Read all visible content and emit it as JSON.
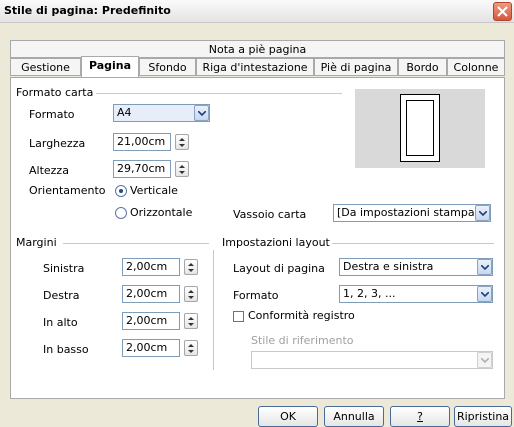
{
  "window": {
    "title": "Stile di pagina: Predefinito"
  },
  "tabs": {
    "top_row": [
      {
        "label": "Nota a piè pagina"
      }
    ],
    "bottom_row": [
      {
        "label": "Gestione"
      },
      {
        "label": "Pagina",
        "active": true
      },
      {
        "label": "Sfondo"
      },
      {
        "label": "Riga d'intestazione"
      },
      {
        "label": "Piè di pagina"
      },
      {
        "label": "Bordo"
      },
      {
        "label": "Colonne"
      }
    ]
  },
  "formato_carta": {
    "title": "Formato carta",
    "formato_label": "Formato",
    "formato_value": "A4",
    "larghezza_label": "Larghezza",
    "larghezza_value": "21,00cm",
    "altezza_label": "Altezza",
    "altezza_value": "29,70cm",
    "orientamento_label": "Orientamento",
    "verticale_label": "Verticale",
    "verticale_selected": true,
    "orizzontale_label": "Orizzontale",
    "vassoio_label": "Vassoio carta",
    "vassoio_value": "[Da impostazioni stampante]"
  },
  "margini": {
    "title": "Margini",
    "sinistra_label": "Sinistra",
    "sinistra_value": "2,00cm",
    "destra_label": "Destra",
    "destra_value": "2,00cm",
    "alto_label": "In alto",
    "alto_value": "2,00cm",
    "basso_label": "In basso",
    "basso_value": "2,00cm"
  },
  "impostazioni_layout": {
    "title": "Impostazioni layout",
    "layout_label": "Layout di pagina",
    "layout_value": "Destra e sinistra",
    "formato_label": "Formato",
    "formato_value": "1, 2, 3, ...",
    "conformita_label": "Conformità registro",
    "conformita_checked": false,
    "stile_label": "Stile di riferimento",
    "stile_value": ""
  },
  "buttons": {
    "ok": "OK",
    "annulla": "Annulla",
    "help": "?",
    "ripristina": "Ripristina"
  },
  "colors": {
    "close_button": "#d8563a",
    "panel": "#ffffff",
    "dialog": "#ece9d8"
  }
}
